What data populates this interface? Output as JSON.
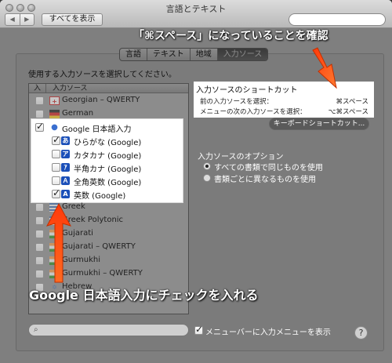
{
  "window": {
    "title": "言語とテキスト",
    "back": "◀",
    "forward": "▶",
    "show_all": "すべてを表示"
  },
  "tabs": [
    {
      "label": "言語",
      "active": false
    },
    {
      "label": "テキスト",
      "active": false
    },
    {
      "label": "地域",
      "active": false
    },
    {
      "label": "入力ソース",
      "active": true
    }
  ],
  "instruction": "使用する入力ソースを選択してください。",
  "list": {
    "col_enable": "入",
    "col_source": "入力ソース",
    "rows": [
      {
        "label": "Georgian – QWERTY",
        "checked": false,
        "icon": "georgia-flag-icon"
      },
      {
        "label": "German",
        "checked": false,
        "icon": "germany-flag-icon"
      },
      {
        "label": "Google 日本語入力",
        "checked": true,
        "icon": "google-ime-icon"
      },
      {
        "label": "ひらがな (Google)",
        "checked": true,
        "icon": "hiragana-icon",
        "glyph": "あ"
      },
      {
        "label": "カタカナ (Google)",
        "checked": false,
        "icon": "katakana-icon",
        "glyph": "ア"
      },
      {
        "label": "半角カナ (Google)",
        "checked": false,
        "icon": "halfwidth-kana-icon",
        "glyph": "ｱ"
      },
      {
        "label": "全角英数 (Google)",
        "checked": false,
        "icon": "fullwidth-alnum-icon",
        "glyph": "Ａ"
      },
      {
        "label": "英数 (Google)",
        "checked": true,
        "icon": "alnum-icon",
        "glyph": "A"
      },
      {
        "label": "Greek",
        "checked": false,
        "icon": "greece-flag-icon"
      },
      {
        "label": "Greek Polytonic",
        "checked": false,
        "icon": "greece-flag-icon"
      },
      {
        "label": "Gujarati",
        "checked": false,
        "icon": "gujarati-icon"
      },
      {
        "label": "Gujarati – QWERTY",
        "checked": false,
        "icon": "gujarati-icon"
      },
      {
        "label": "Gurmukhi",
        "checked": false,
        "icon": "gurmukhi-icon"
      },
      {
        "label": "Gurmukhi – QWERTY",
        "checked": false,
        "icon": "gurmukhi-icon"
      },
      {
        "label": "Hebrew",
        "checked": false,
        "icon": "israel-flag-icon"
      }
    ]
  },
  "shortcuts": {
    "title": "入力ソースのショートカット",
    "prev_label": "前の入力ソースを選択：",
    "prev_key": "⌘スペース",
    "next_label": "メニューの次の入力ソースを選択：",
    "next_key": "⌥⌘スペース",
    "keyboard_button": "キーボードショートカット..."
  },
  "options": {
    "title": "入力ソースのオプション",
    "same_all": "すべての書類で同じものを使用",
    "per_doc": "書類ごとに異なるものを使用"
  },
  "menubar_checkbox": "メニューバーに入力メニューを表示",
  "help": "?",
  "annotations": {
    "top": "「⌘スペース」になっていることを確認",
    "bottom": "Google 日本語入力にチェックを入れる"
  },
  "colors": {
    "arrow": "#ff5a1a"
  }
}
